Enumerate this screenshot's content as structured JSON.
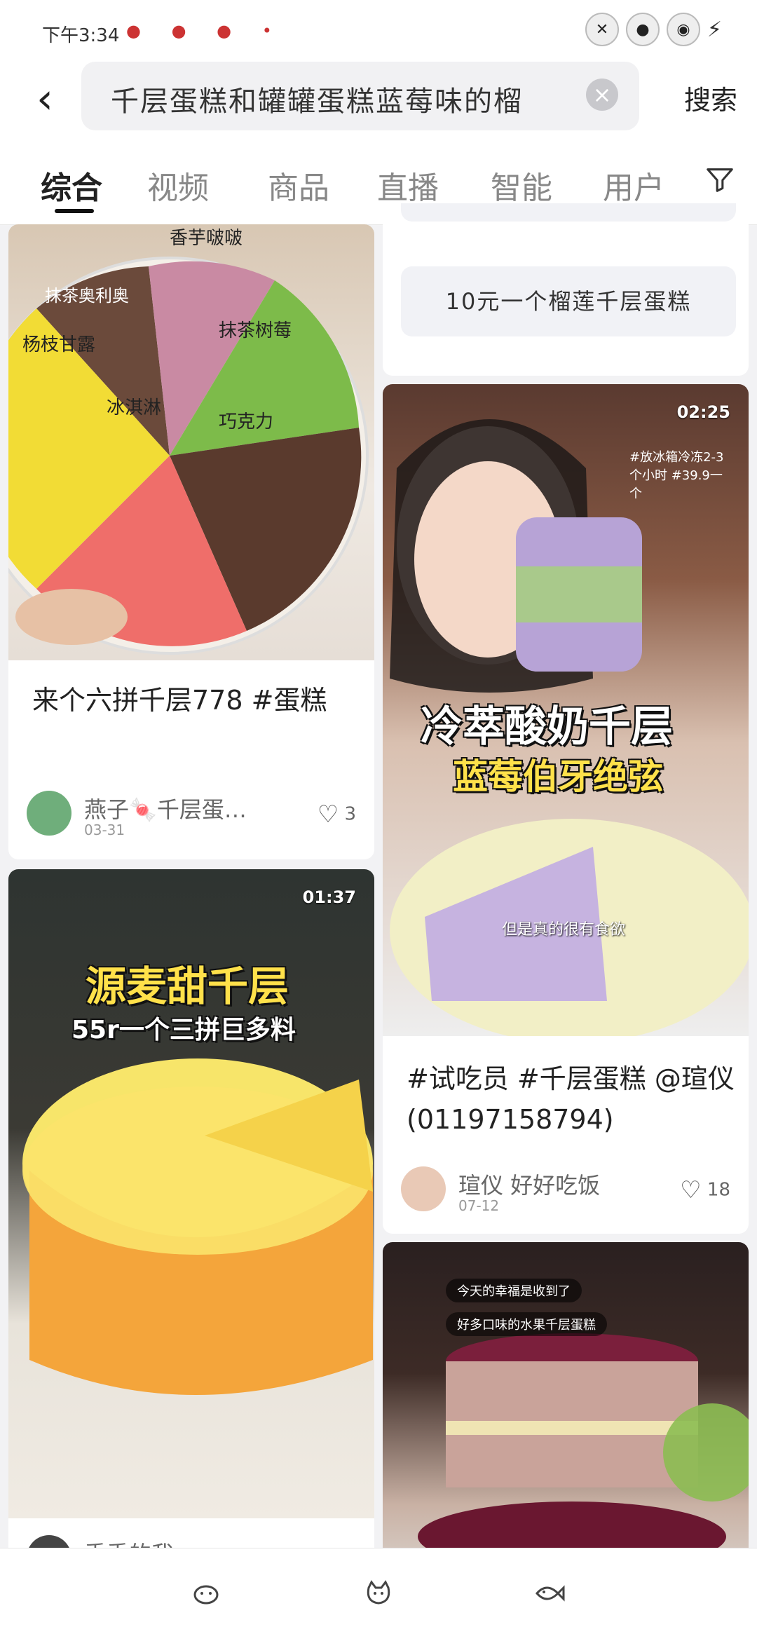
{
  "status_bar": {
    "time": "下午3:34"
  },
  "search": {
    "query": "千层蛋糕和罐罐蛋糕蓝莓味的榴",
    "button": "搜索"
  },
  "tabs": [
    "综合",
    "视频",
    "商品",
    "直播",
    "智能",
    "用户"
  ],
  "suggestion": "10元一个榴莲千层蛋糕",
  "cards": [
    {
      "image_labels": [
        "香芋啵啵",
        "抹茶奥利奥",
        "抹茶树莓",
        "杨枝甘露",
        "冰淇淋",
        "巧克力"
      ],
      "title": "来个六拼千层778 #蛋糕",
      "author": "燕子🍬千层蛋…",
      "date": "03-31",
      "likes": "3"
    },
    {
      "duration": "02:25",
      "overlay_tag": "#放冰箱冷冻2-3个小时 #39.9一个",
      "caption_main": "冷萃酸奶千层",
      "caption_sub": "蓝莓伯牙绝弦",
      "caption_small": "但是真的很有食欲",
      "title": "#试吃员 #千层蛋糕 @瑄仪(01197158794)",
      "author": "瑄仪 好好吃饭",
      "date": "07-12",
      "likes": "18"
    },
    {
      "duration": "01:37",
      "caption_main": "源麦甜千层",
      "caption_sub": "55r一个三拼巨多料",
      "author": "乖乖的我"
    },
    {
      "chips": [
        "今天的幸福是收到了",
        "好多口味的水果千层蛋糕"
      ]
    }
  ]
}
